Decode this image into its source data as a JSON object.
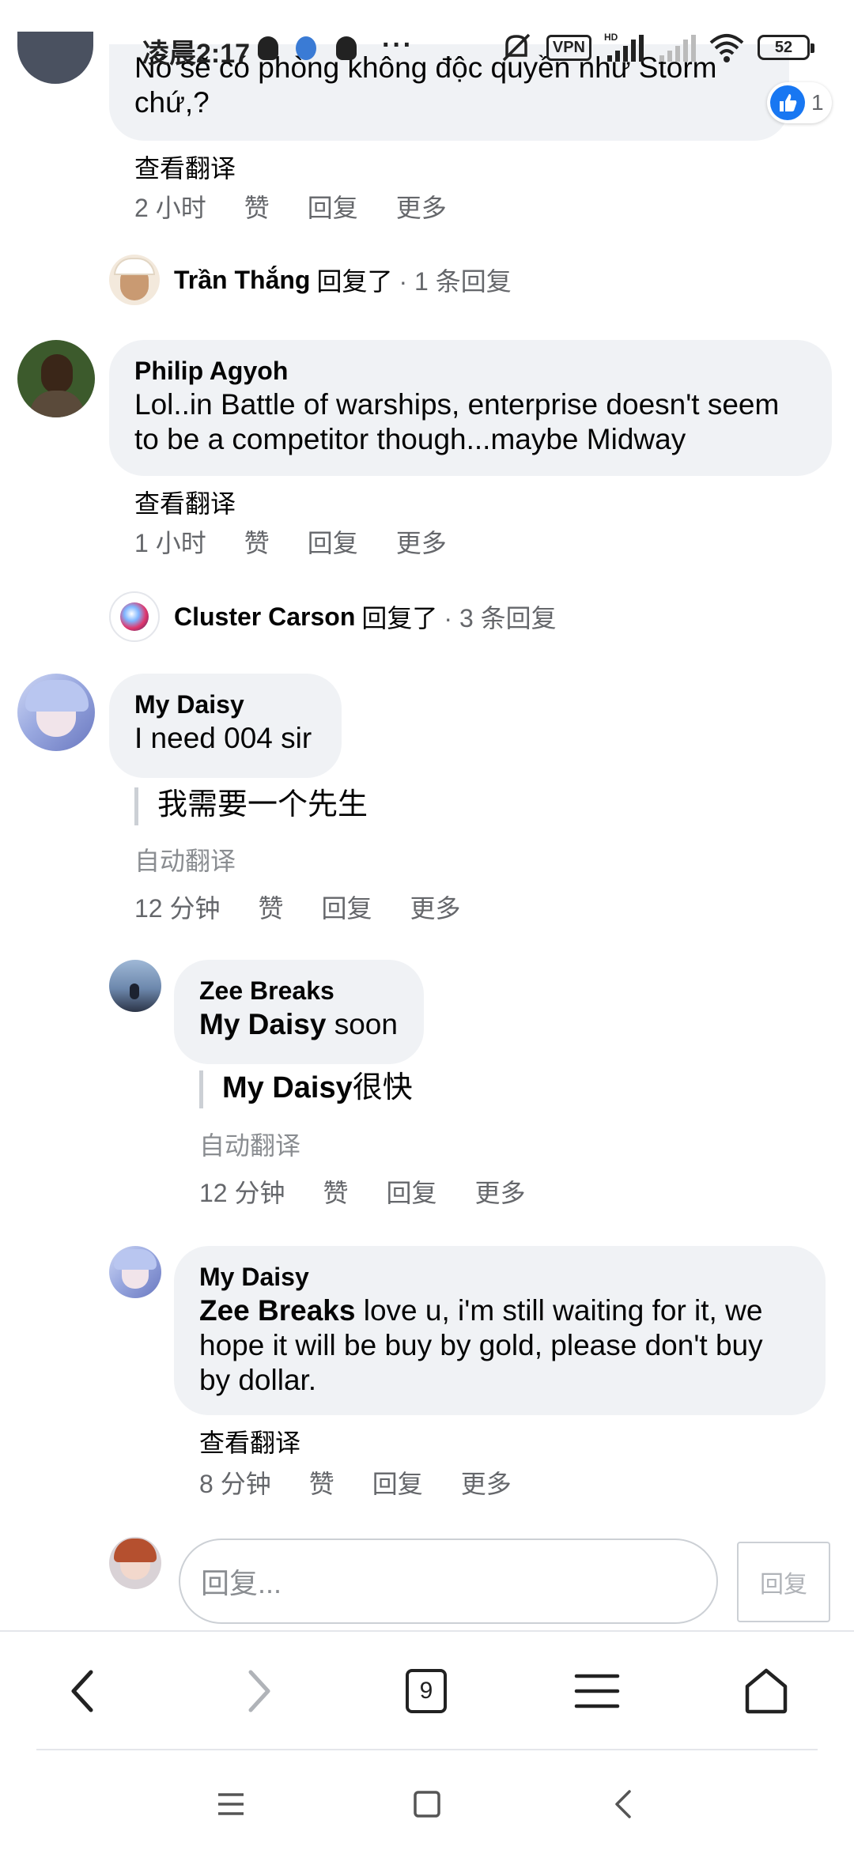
{
  "status_bar": {
    "time": "凌晨2:17",
    "dots": "···",
    "vpn": "VPN",
    "battery": "52"
  },
  "comments": {
    "top": {
      "text_line1": "Nó sẽ có phòng không độc quyền như Storm",
      "text_line2": "chứ,?",
      "see_translation": "查看翻译",
      "time": "2 小时",
      "like": "赞",
      "reply": "回复",
      "more": "更多",
      "reaction_count": "1"
    },
    "thang_summary": {
      "name": "Trần Thắng",
      "verb": "回复了",
      "count": "· 1 条回复"
    },
    "philip": {
      "author": "Philip Agyoh",
      "text_line1": "Lol..in Battle of warships, enterprise doesn't seem",
      "text_line2": "to be a competitor though...maybe Midway",
      "see_translation": "查看翻译",
      "time": "1 小时",
      "like": "赞",
      "reply": "回复",
      "more": "更多"
    },
    "carson_summary": {
      "name": "Cluster Carson",
      "verb": "回复了",
      "count": "· 3 条回复"
    },
    "daisy1": {
      "author": "My Daisy",
      "text": "I need 004 sir",
      "translation": "我需要一个先生",
      "auto_label": "自动翻译",
      "time": "12 分钟",
      "like": "赞",
      "reply": "回复",
      "more": "更多"
    },
    "zee": {
      "author": "Zee Breaks",
      "mention": "My Daisy",
      "text": " soon",
      "translation_mention": "My Daisy",
      "translation_text": "很快",
      "auto_label": "自动翻译",
      "time": "12 分钟",
      "like": "赞",
      "reply": "回复",
      "more": "更多"
    },
    "daisy2": {
      "author": "My Daisy",
      "mention": "Zee Breaks",
      "text_line1": " love u, i'm still waiting for it, we",
      "text_line2": "hope it will be buy by gold, please don't buy",
      "text_line3": "by dollar.",
      "see_translation": "查看翻译",
      "time": "8 分钟",
      "like": "赞",
      "reply": "回复",
      "more": "更多"
    }
  },
  "composer": {
    "placeholder": "回复...",
    "send_label": "回复"
  },
  "toolbar": {
    "tab_count": "9"
  },
  "colors": {
    "bubble": "#f0f2f5",
    "secondary_text": "#65676b",
    "like_blue": "#1877f2"
  },
  "icons": [
    "penguin-icon",
    "alarm-icon",
    "mute-icon",
    "signal-icon",
    "wifi-icon",
    "like-icon",
    "back-icon",
    "forward-icon",
    "tabs-icon",
    "menu-icon",
    "home-icon"
  ]
}
